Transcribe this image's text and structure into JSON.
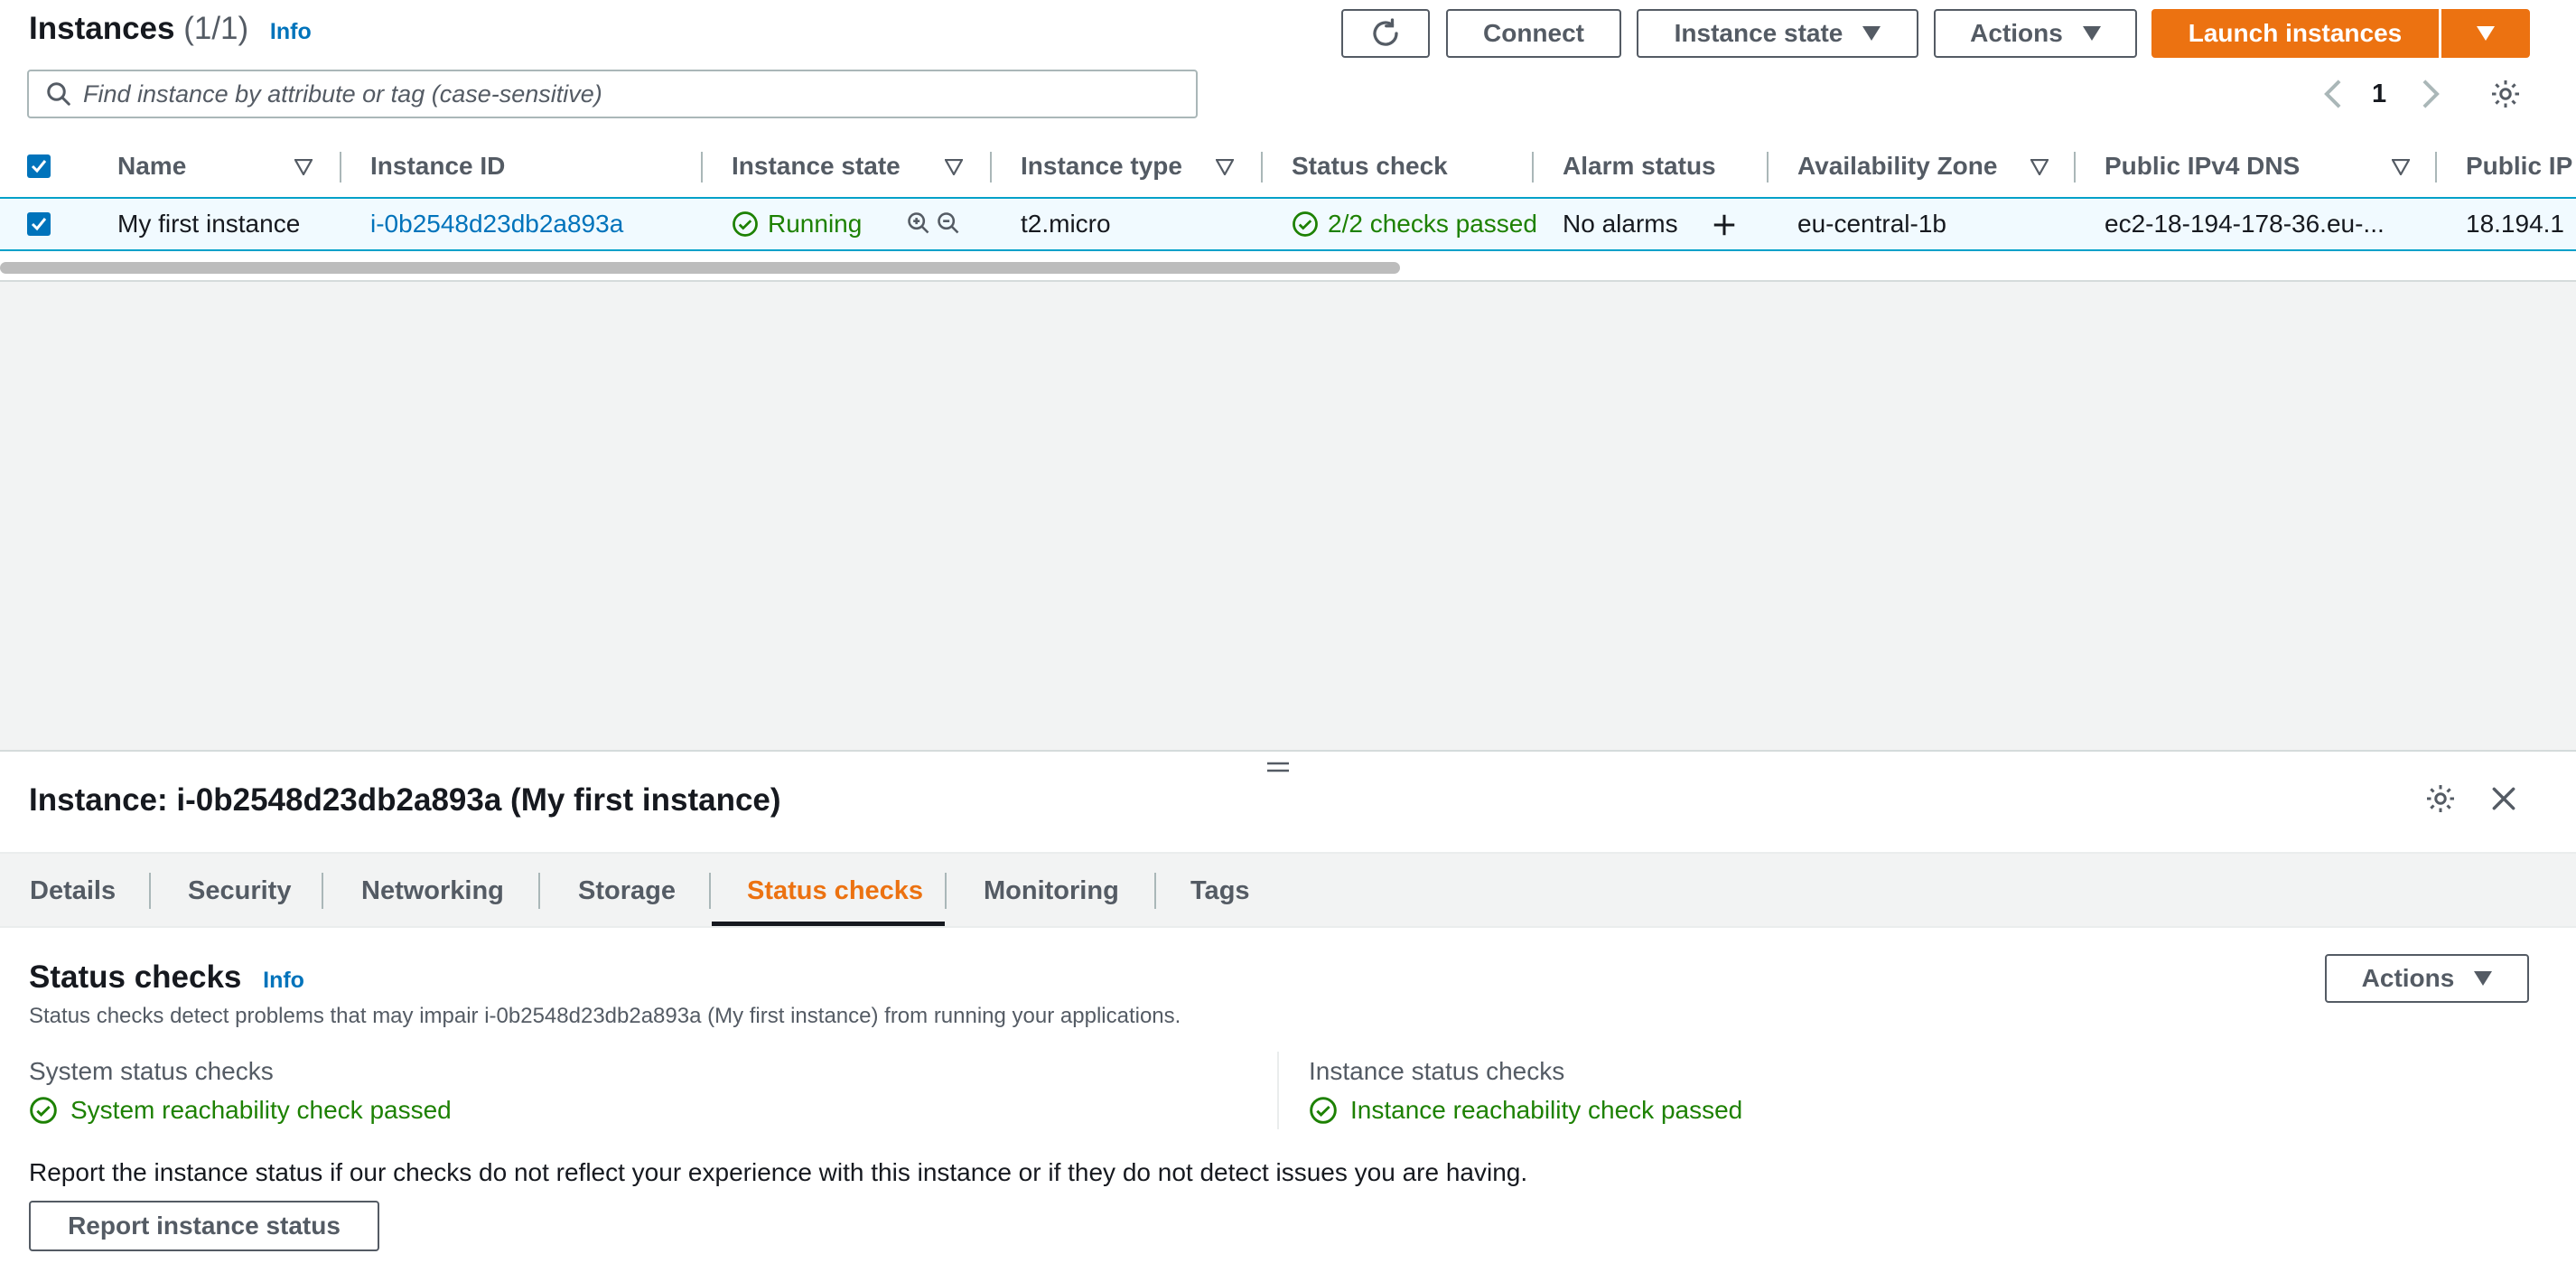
{
  "header": {
    "title": "Instances",
    "count": "(1/1)",
    "info": "Info",
    "connect": "Connect",
    "instance_state": "Instance state",
    "actions": "Actions",
    "launch": "Launch instances",
    "search_placeholder": "Find instance by attribute or tag (case-sensitive)",
    "page": "1"
  },
  "table": {
    "columns": [
      "Name",
      "Instance ID",
      "Instance state",
      "Instance type",
      "Status check",
      "Alarm status",
      "Availability Zone",
      "Public IPv4 DNS",
      "Public IP"
    ],
    "row": {
      "name": "My first instance",
      "instance_id": "i-0b2548d23db2a893a",
      "state": "Running",
      "type": "t2.micro",
      "status_check": "2/2 checks passed",
      "alarm": "No alarms",
      "az": "eu-central-1b",
      "dns": "ec2-18-194-178-36.eu-...",
      "ip": "18.194.1"
    }
  },
  "panel": {
    "title": "Instance: i-0b2548d23db2a893a (My first instance)",
    "tabs": [
      "Details",
      "Security",
      "Networking",
      "Storage",
      "Status checks",
      "Monitoring",
      "Tags"
    ],
    "active_tab": "Status checks",
    "section_title": "Status checks",
    "info": "Info",
    "actions": "Actions",
    "description": "Status checks detect problems that may impair i-0b2548d23db2a893a (My first instance) from running your applications.",
    "system_label": "System status checks",
    "system_status": "System reachability check passed",
    "instance_label": "Instance status checks",
    "instance_status": "Instance reachability check passed",
    "report_text": "Report the instance status if our checks do not reflect your experience with this instance or if they do not detect issues you are having.",
    "report_button": "Report instance status"
  },
  "colors": {
    "accent": "#ec7211",
    "link": "#0073bb",
    "success": "#1d8102"
  }
}
